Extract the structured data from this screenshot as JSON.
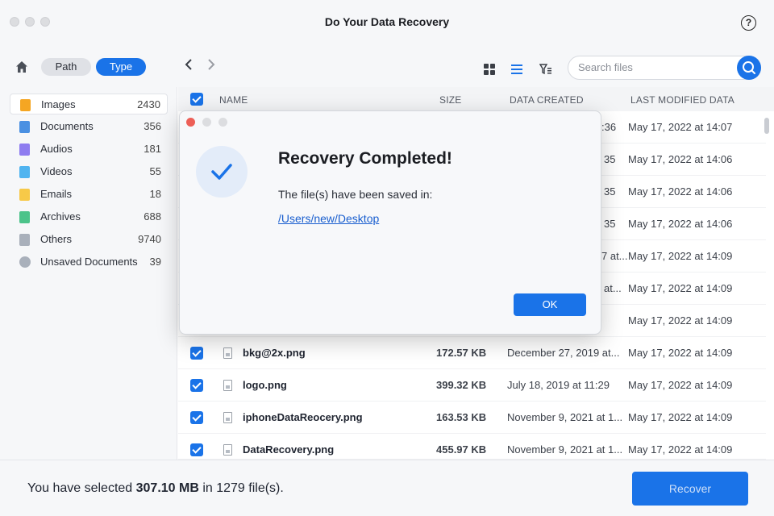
{
  "window": {
    "title": "Do Your Data Recovery"
  },
  "toolbar": {
    "path_label": "Path",
    "type_label": "Type",
    "search_placeholder": "Search files"
  },
  "sidebar": {
    "items": [
      {
        "label": "Images",
        "count": "2430",
        "color": "#f5a623"
      },
      {
        "label": "Documents",
        "count": "356",
        "color": "#4a90e2"
      },
      {
        "label": "Audios",
        "count": "181",
        "color": "#8e7cf0"
      },
      {
        "label": "Videos",
        "count": "55",
        "color": "#50b4f0"
      },
      {
        "label": "Emails",
        "count": "18",
        "color": "#f7c948"
      },
      {
        "label": "Archives",
        "count": "688",
        "color": "#4cc38a"
      },
      {
        "label": "Others",
        "count": "9740",
        "color": "#a9b0bb"
      },
      {
        "label": "Unsaved Documents",
        "count": "39",
        "color": "#a9b0bb"
      }
    ]
  },
  "table": {
    "headers": {
      "name": "NAME",
      "size": "SIZE",
      "created": "DATA CREATED",
      "modified": "LAST MODIFIED DATA"
    },
    "partial_rows": [
      {
        "created_tail": ":36",
        "modified": "May 17, 2022 at 14:07"
      },
      {
        "created_tail": "35",
        "modified": "May 17, 2022 at 14:06"
      },
      {
        "created_tail": "35",
        "modified": "May 17, 2022 at 14:06"
      },
      {
        "created_tail": "35",
        "modified": "May 17, 2022 at 14:06"
      },
      {
        "created_tail": "7 at...",
        "modified": "May 17, 2022 at 14:09"
      },
      {
        "created_tail": "at...",
        "modified": "May 17, 2022 at 14:09"
      },
      {
        "created_tail": "",
        "modified": "May 17, 2022 at 14:09"
      }
    ],
    "rows": [
      {
        "name": "bkg@2x.png",
        "size": "172.57 KB",
        "created": "December 27, 2019 at...",
        "modified": "May 17, 2022 at 14:09"
      },
      {
        "name": "logo.png",
        "size": "399.32 KB",
        "created": "July 18, 2019 at 11:29",
        "modified": "May 17, 2022 at 14:09"
      },
      {
        "name": "iphoneDataReocery.png",
        "size": "163.53 KB",
        "created": "November 9, 2021 at 1...",
        "modified": "May 17, 2022 at 14:09"
      },
      {
        "name": "DataRecovery.png",
        "size": "455.97 KB",
        "created": "November 9, 2021 at 1...",
        "modified": "May 17, 2022 at 14:09"
      }
    ]
  },
  "footer": {
    "prefix": "You have selected ",
    "size": "307.10 MB",
    "middle": " in 1279 file(s).",
    "recover_label": "Recover"
  },
  "dialog": {
    "title": "Recovery Completed!",
    "message": "The file(s) have been saved in:",
    "path": "/Users/new/Desktop",
    "ok_label": "OK"
  }
}
